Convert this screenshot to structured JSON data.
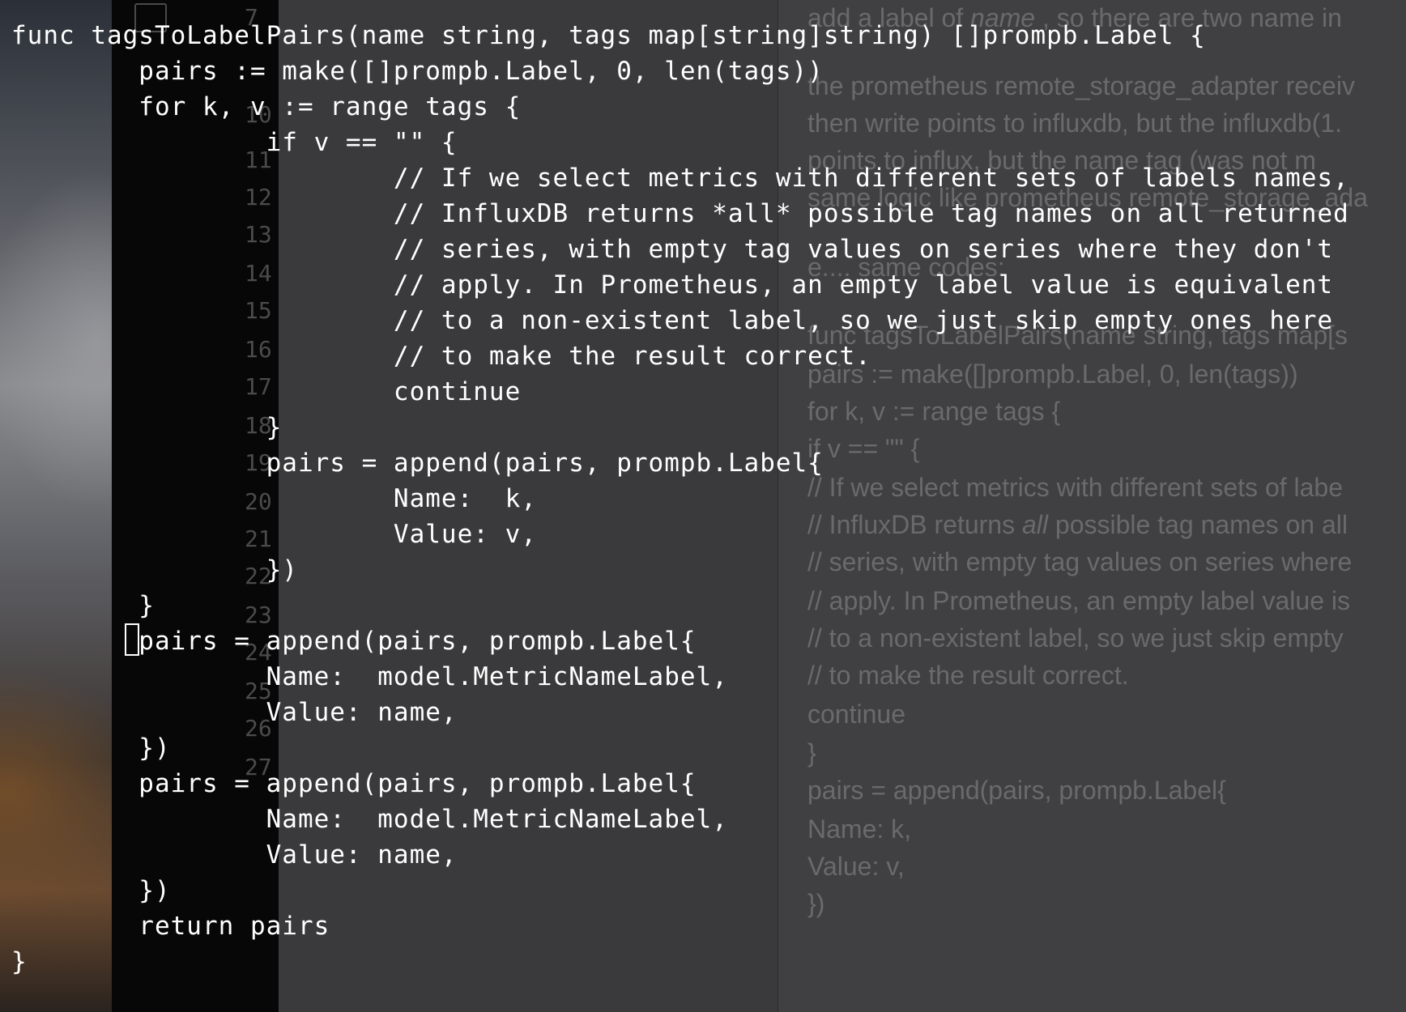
{
  "right_doc": {
    "lines": [
      {
        "pre": "add a label of ",
        "em": "name",
        "post": " , so there are two name in"
      },
      {
        "pre": "the prometheus remote_storage_adapter receiv"
      },
      {
        "pre": "then write points to influxdb, but the influxdb(1."
      },
      {
        "pre": "points to influx, but the name tag (was not m"
      },
      {
        "pre": "same logic like prometheus remote_storage_ada"
      },
      {
        "pre": "e.... same codes:"
      },
      {
        "pre": "func tagsToLabelPairs(name string, tags map[s"
      },
      {
        "pre": "pairs := make([]prompb.Label, 0, len(tags))"
      },
      {
        "pre": "for k, v := range tags {"
      },
      {
        "pre": "if v == \"\" {"
      },
      {
        "pre": "// If we select metrics with different sets of labe"
      },
      {
        "pre": "// InfluxDB returns ",
        "em": "all",
        "post": " possible tag names on all"
      },
      {
        "pre": "// series, with empty tag values on series where"
      },
      {
        "pre": "// apply. In Prometheus, an empty label value is"
      },
      {
        "pre": "// to a non-existent label, so we just skip empty"
      },
      {
        "pre": "// to make the result correct."
      },
      {
        "pre": "continue"
      },
      {
        "pre": "}"
      },
      {
        "pre": "pairs = append(pairs, prompb.Label{"
      },
      {
        "pre": "Name: k,"
      },
      {
        "pre": "Value: v,"
      },
      {
        "pre": "})"
      }
    ]
  },
  "gutter": [
    "7",
    "10",
    "11",
    "12",
    "13",
    "14",
    "15",
    "16",
    "17",
    "18",
    "19",
    "20",
    "21",
    "22",
    "23",
    "24",
    "25",
    "26",
    "27"
  ],
  "code_lines": [
    "func tagsToLabelPairs(name string, tags map[string]string) []prompb.Label {",
    "        pairs := make([]prompb.Label, 0, len(tags))",
    "        for k, v := range tags {",
    "                if v == \"\" {",
    "                        // If we select metrics with different sets of labels names,",
    "                        // InfluxDB returns *all* possible tag names on all returned",
    "                        // series, with empty tag values on series where they don't",
    "                        // apply. In Prometheus, an empty label value is equivalent",
    "                        // to a non-existent label, so we just skip empty ones here",
    "                        // to make the result correct.",
    "                        continue",
    "                }",
    "                pairs = append(pairs, prompb.Label{",
    "                        Name:  k,",
    "                        Value: v,",
    "                })",
    "        }",
    "        pairs = append(pairs, prompb.Label{",
    "                Name:  model.MetricNameLabel,",
    "                Value: name,",
    "        })",
    "        pairs = append(pairs, prompb.Label{",
    "                Name:  model.MetricNameLabel,",
    "                Value: name,",
    "        })",
    "        return pairs",
    "}"
  ]
}
